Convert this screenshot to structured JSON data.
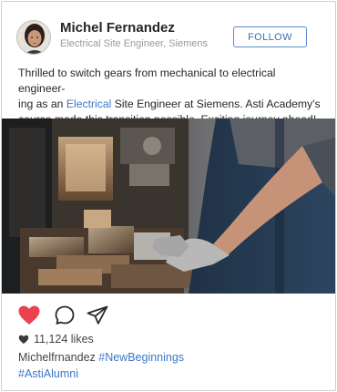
{
  "post": {
    "author_name": "Michel Fernandez",
    "author_subtitle": "Electrical Site Engineer,  Siemens",
    "follow_label": "FOLLOW",
    "caption": {
      "line1": "Thrilled to switch gears from mechanical to electrical engineer-",
      "line2_pre": "ing as an ",
      "line2_highlight": "Electrical",
      "line2_post": " Site Engineer at Siemens. Asti Academy's",
      "line3": "course made this transition possible. Exciting journey ahead!"
    },
    "photo_icon": "industrial-machining-photo",
    "actions": {
      "like_icon": "heart-icon",
      "comment_icon": "comment-icon",
      "share_icon": "send-icon",
      "liked": true
    },
    "likes_text": "11,124 likes",
    "footer": {
      "username": "Michelfrnandez",
      "hashtag1": "#NewBeginnings",
      "hashtag2": "#AstiAlumni"
    }
  },
  "colors": {
    "accent": "#3a77c9",
    "like": "#e8434f",
    "follow_border": "#5a8cc7"
  }
}
